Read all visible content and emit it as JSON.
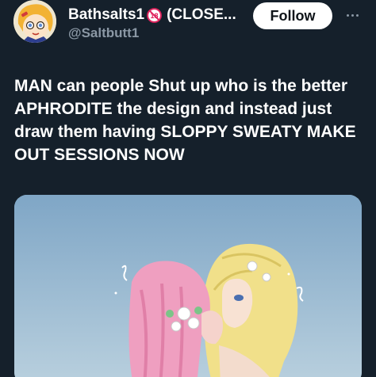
{
  "post": {
    "author": {
      "display_name": "Bathsalts1",
      "name_suffix": "(CLOSE...",
      "handle": "@Saltbutt1",
      "badge_icon": "no-under-18-icon",
      "badge_color": "#e0245e"
    },
    "follow_label": "Follow",
    "more_icon": "more-horizontal-icon",
    "text": "MAN can people Shut up who is the better APHRODITE the design and instead just draw them having SLOPPY SWEATY MAKE OUT SESSIONS NOW",
    "media": {
      "kind": "illustration"
    }
  },
  "colors": {
    "background": "#15202b",
    "text_primary": "#ffffff",
    "text_secondary": "#8b98a5",
    "follow_bg": "#ffffff",
    "follow_text": "#0f1419"
  }
}
